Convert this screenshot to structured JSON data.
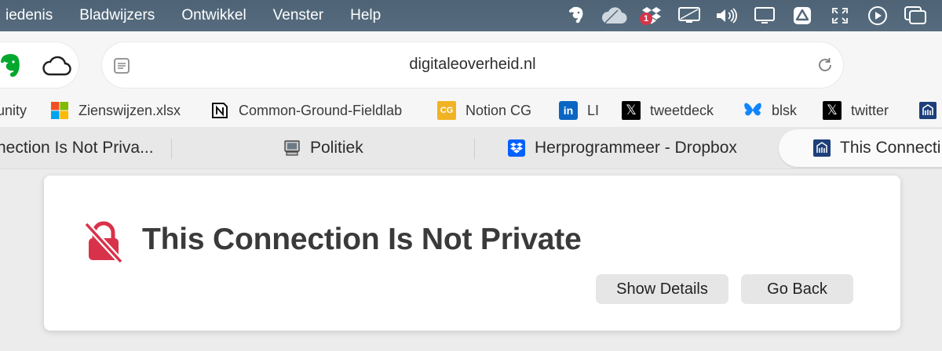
{
  "menubar": {
    "items": [
      "iedenis",
      "Bladwijzers",
      "Ontwikkel",
      "Venster",
      "Help"
    ],
    "status_icons": [
      "evernote-elephant-icon",
      "cloud-icon",
      "dropbox-icon",
      "display-mirroring-icon",
      "volume-icon",
      "screen-icon",
      "google-drive-icon",
      "resize-icon",
      "play-circle-icon",
      "window-stack-icon"
    ],
    "dropbox_badge": "1"
  },
  "toolbar": {
    "extensions": [
      "evernote-icon",
      "cloud-icon"
    ],
    "url": "digitaleoverheid.nl"
  },
  "bookmarks": [
    {
      "label": "unity",
      "icon": ""
    },
    {
      "label": "Zienswijzen.xlsx",
      "icon": "microsoft-icon"
    },
    {
      "label": "Common-Ground-Fieldlab",
      "icon": "notion-icon"
    },
    {
      "label": "Notion CG",
      "icon": "cg-icon",
      "badge": "CG"
    },
    {
      "label": "LI",
      "icon": "linkedin-icon",
      "badge": "in"
    },
    {
      "label": "tweetdeck",
      "icon": "x-icon",
      "badge": "𝕏"
    },
    {
      "label": "blsk",
      "icon": "bluesky-icon"
    },
    {
      "label": "twitter",
      "icon": "x-icon",
      "badge": "𝕏"
    },
    {
      "label": "",
      "icon": "government-crest-icon"
    }
  ],
  "tabs": [
    {
      "label": "nection Is Not Priva...",
      "active": false
    },
    {
      "label": "Politiek",
      "active": false
    },
    {
      "label": "Herprogrammeer - Dropbox",
      "active": false
    },
    {
      "label": "This Connecti",
      "active": true
    }
  ],
  "error": {
    "title": "This Connection Is Not Private",
    "show_details": "Show Details",
    "go_back": "Go Back"
  },
  "colors": {
    "menubar_bg": "#526879",
    "warning_red": "#d8324a",
    "button_bg": "#e6e6e6"
  }
}
